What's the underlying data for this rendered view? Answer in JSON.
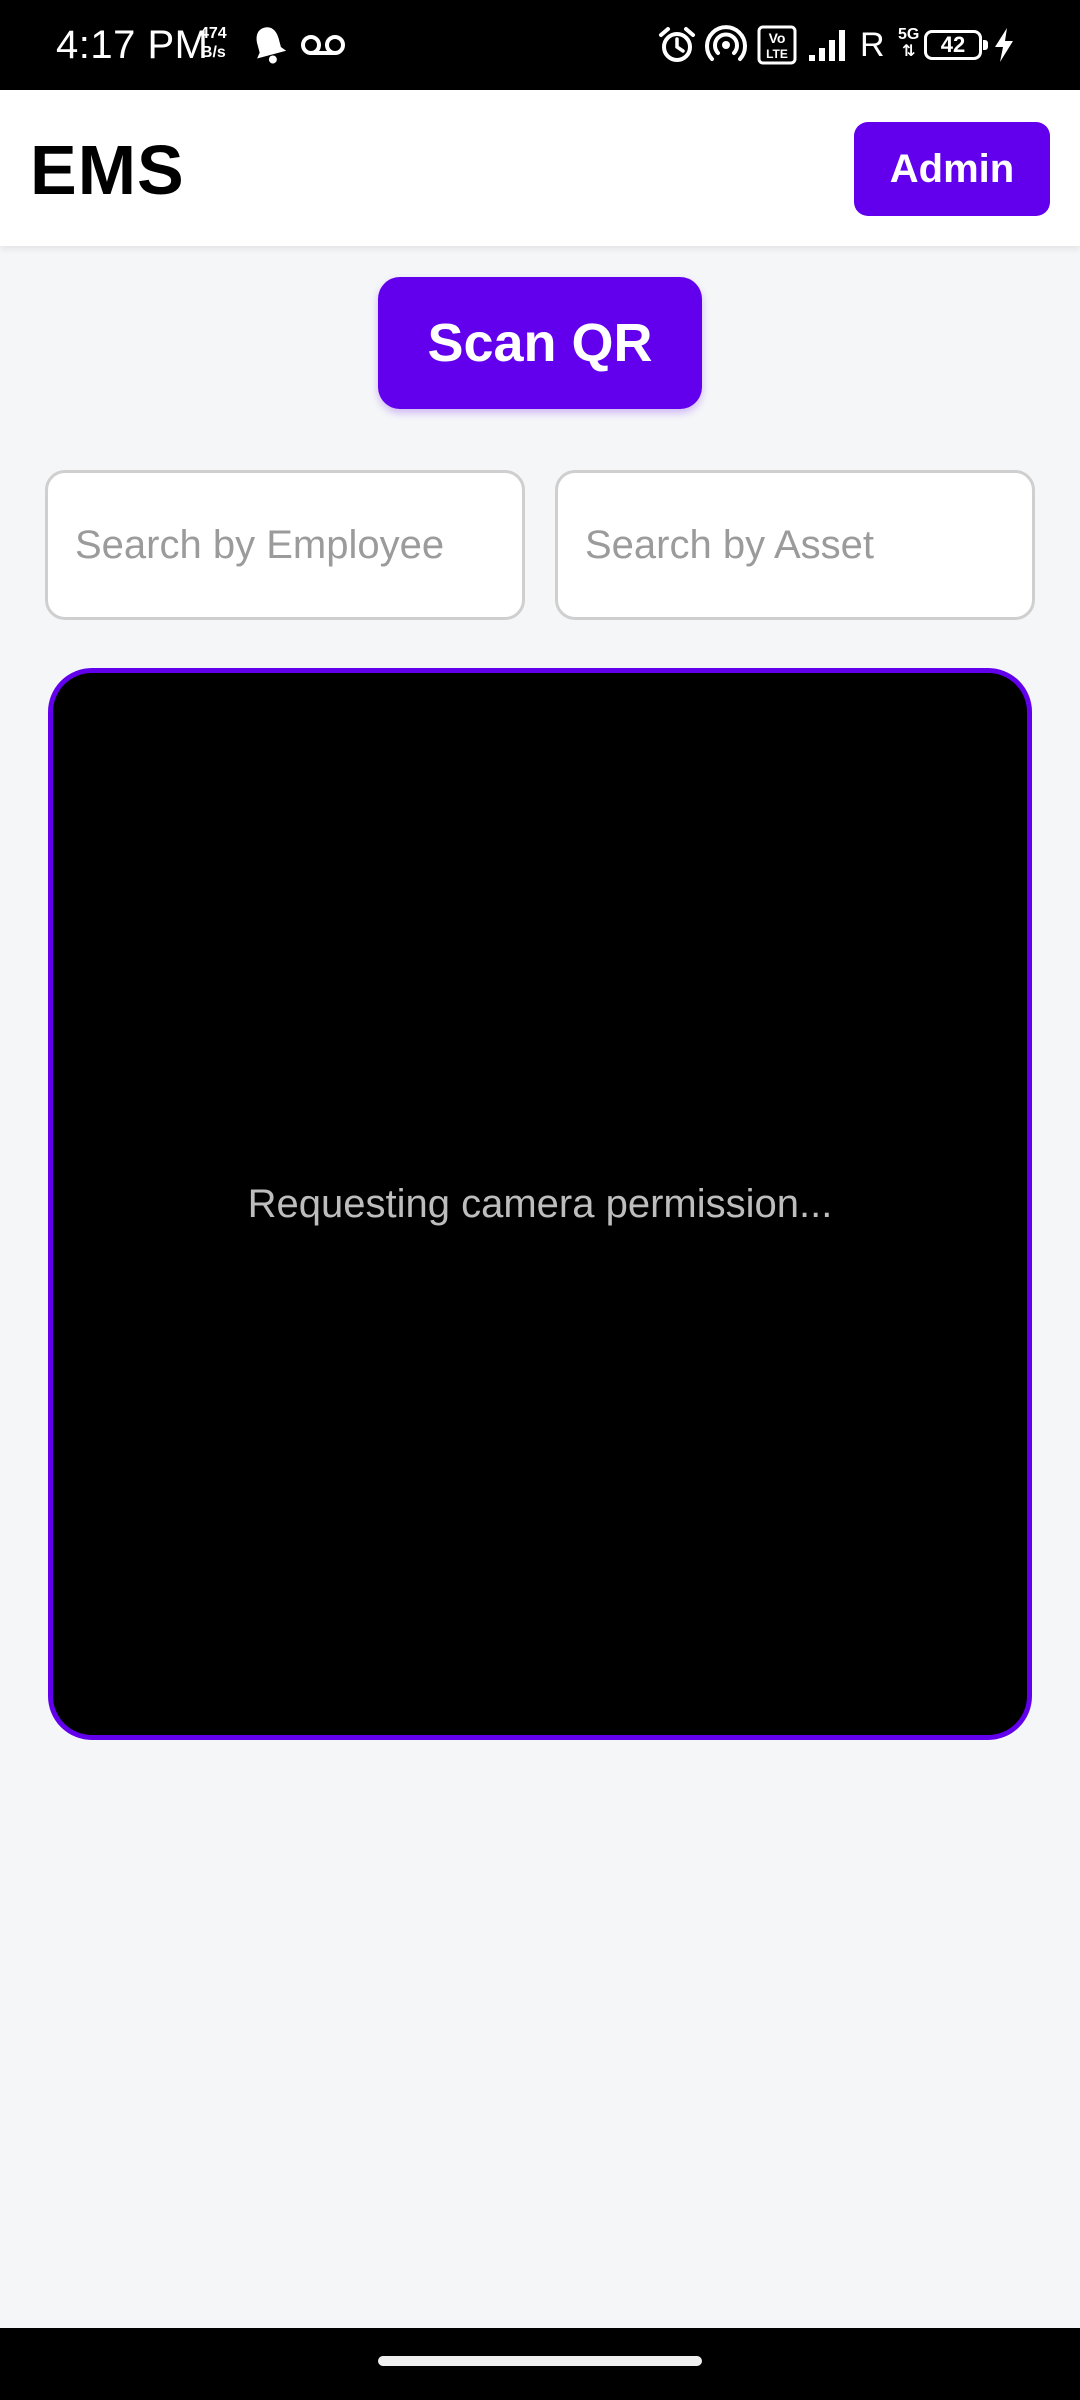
{
  "status_bar": {
    "time": "4:17 PM",
    "net_speed_value": "474",
    "net_speed_unit": "B/s",
    "roaming": "R",
    "network_type": "5G",
    "battery_level": "42",
    "icons": [
      "bell-icon",
      "voicemail-icon",
      "alarm-icon",
      "hotspot-icon",
      "volte-icon",
      "signal-icon",
      "charging-icon"
    ]
  },
  "header": {
    "title": "EMS",
    "admin_label": "Admin"
  },
  "actions": {
    "scan_label": "Scan QR"
  },
  "search": {
    "employee_placeholder": "Search by Employee",
    "employee_value": "",
    "asset_placeholder": "Search by Asset",
    "asset_value": ""
  },
  "camera": {
    "status_message": "Requesting camera permission..."
  },
  "colors": {
    "accent": "#6200ee",
    "background": "#f5f6f8",
    "camera_bg": "#000000"
  }
}
